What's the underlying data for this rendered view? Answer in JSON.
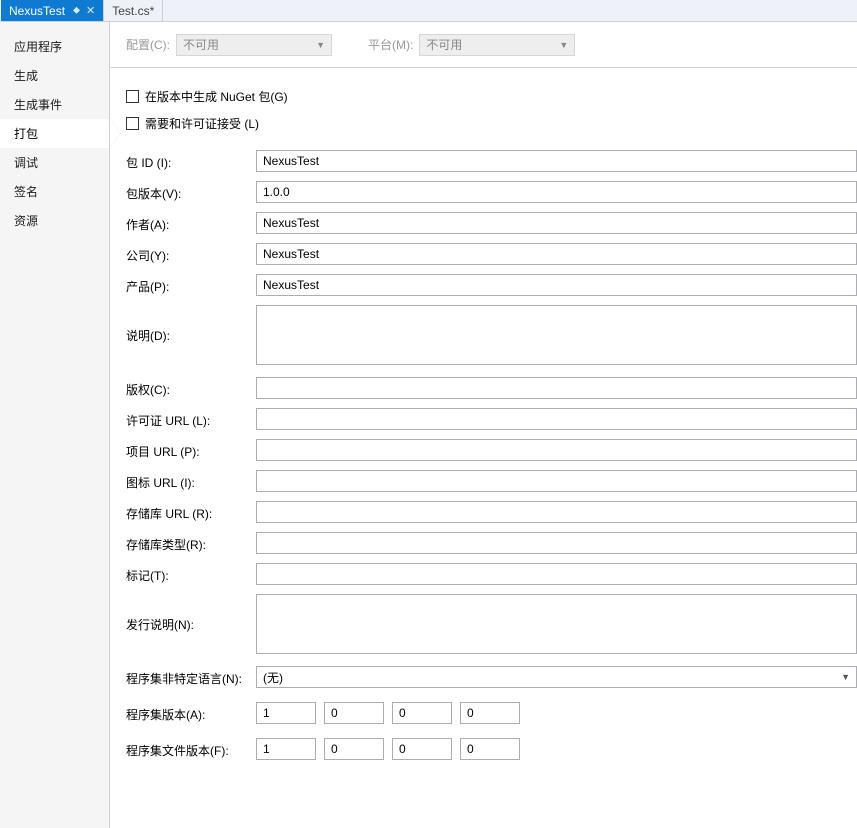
{
  "tabs": [
    {
      "label": "NexusTest",
      "active": true,
      "pinned": true,
      "closable": true
    },
    {
      "label": "Test.cs*",
      "active": false,
      "pinned": false,
      "closable": false
    }
  ],
  "sidebar": {
    "items": [
      {
        "label": "应用程序"
      },
      {
        "label": "生成"
      },
      {
        "label": "生成事件"
      },
      {
        "label": "打包",
        "selected": true
      },
      {
        "label": "调试"
      },
      {
        "label": "签名"
      },
      {
        "label": "资源"
      }
    ]
  },
  "toolbar": {
    "config_label": "配置(C):",
    "config_value": "不可用",
    "platform_label": "平台(M):",
    "platform_value": "不可用"
  },
  "checks": {
    "gen_nuget": "在版本中生成 NuGet 包(G)",
    "require_license": "需要和许可证接受 (L)"
  },
  "fields": {
    "package_id": {
      "label": "包 ID (I):",
      "value": "NexusTest"
    },
    "package_version": {
      "label": "包版本(V):",
      "value": "1.0.0"
    },
    "author": {
      "label": "作者(A):",
      "value": "NexusTest"
    },
    "company": {
      "label": "公司(Y):",
      "value": "NexusTest"
    },
    "product": {
      "label": "产品(P):",
      "value": "NexusTest"
    },
    "description": {
      "label": "说明(D):",
      "value": ""
    },
    "copyright": {
      "label": "版权(C):",
      "value": ""
    },
    "license_url": {
      "label": "许可证 URL (L):",
      "value": ""
    },
    "project_url": {
      "label": "项目 URL (P):",
      "value": ""
    },
    "icon_url": {
      "label": "图标 URL (I):",
      "value": ""
    },
    "repo_url": {
      "label": "存储库 URL (R):",
      "value": ""
    },
    "repo_type": {
      "label": "存储库类型(R):",
      "value": ""
    },
    "tags": {
      "label": "标记(T):",
      "value": ""
    },
    "release_notes": {
      "label": "发行说明(N):",
      "value": ""
    },
    "neutral_lang": {
      "label": "程序集非特定语言(N):",
      "value": "(无)"
    },
    "asm_version": {
      "label": "程序集版本(A):",
      "v1": "1",
      "v2": "0",
      "v3": "0",
      "v4": "0"
    },
    "file_version": {
      "label": "程序集文件版本(F):",
      "v1": "1",
      "v2": "0",
      "v3": "0",
      "v4": "0"
    }
  }
}
